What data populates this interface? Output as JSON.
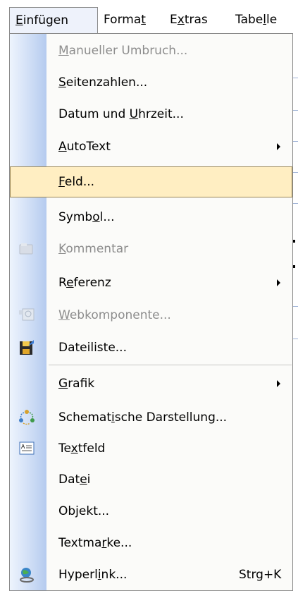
{
  "menubar": {
    "items": [
      {
        "pre": "",
        "ul": "E",
        "post": "infügen"
      },
      {
        "pre": "Forma",
        "ul": "t",
        "post": ""
      },
      {
        "pre": "E",
        "ul": "x",
        "post": "tras"
      },
      {
        "pre": "Tabe",
        "ul": "l",
        "post": "le"
      }
    ]
  },
  "dropdown": {
    "items": [
      {
        "pre": "",
        "ul": "M",
        "post": "anueller Umbruch...",
        "disabled": true
      },
      {
        "pre": "",
        "ul": "S",
        "post": "eitenzahlen..."
      },
      {
        "pre": "Datum und ",
        "ul": "U",
        "post": "hrzeit..."
      },
      {
        "pre": "",
        "ul": "A",
        "post": "utoText",
        "submenu": true
      },
      {
        "pre": "",
        "ul": "F",
        "post": "eld...",
        "selected": true
      },
      {
        "pre": "Symb",
        "ul": "o",
        "post": "l..."
      },
      {
        "pre": "",
        "ul": "K",
        "post": "ommentar",
        "disabled": true,
        "icon": "comment-icon"
      },
      {
        "pre": "R",
        "ul": "e",
        "post": "ferenz",
        "submenu": true
      },
      {
        "pre": "",
        "ul": "W",
        "post": "ebkomponente...",
        "disabled": true,
        "icon": "web-component-icon"
      },
      {
        "pre": "Dateiliste...",
        "ul": "",
        "post": "",
        "icon": "file-list-icon"
      },
      {
        "pre": "",
        "ul": "G",
        "post": "rafik",
        "submenu": true
      },
      {
        "pre": "Schemat",
        "ul": "i",
        "post": "sche Darstellung...",
        "icon": "diagram-icon"
      },
      {
        "pre": "Te",
        "ul": "x",
        "post": "tfeld",
        "icon": "textbox-icon"
      },
      {
        "pre": "Dat",
        "ul": "e",
        "post": "i"
      },
      {
        "pre": "Ob",
        "ul": "j",
        "post": "ekt..."
      },
      {
        "pre": "Textma",
        "ul": "r",
        "post": "ke..."
      },
      {
        "pre": "Hyperl",
        "ul": "i",
        "post": "nk...",
        "shortcut": "Strg+K",
        "icon": "hyperlink-icon"
      }
    ]
  }
}
